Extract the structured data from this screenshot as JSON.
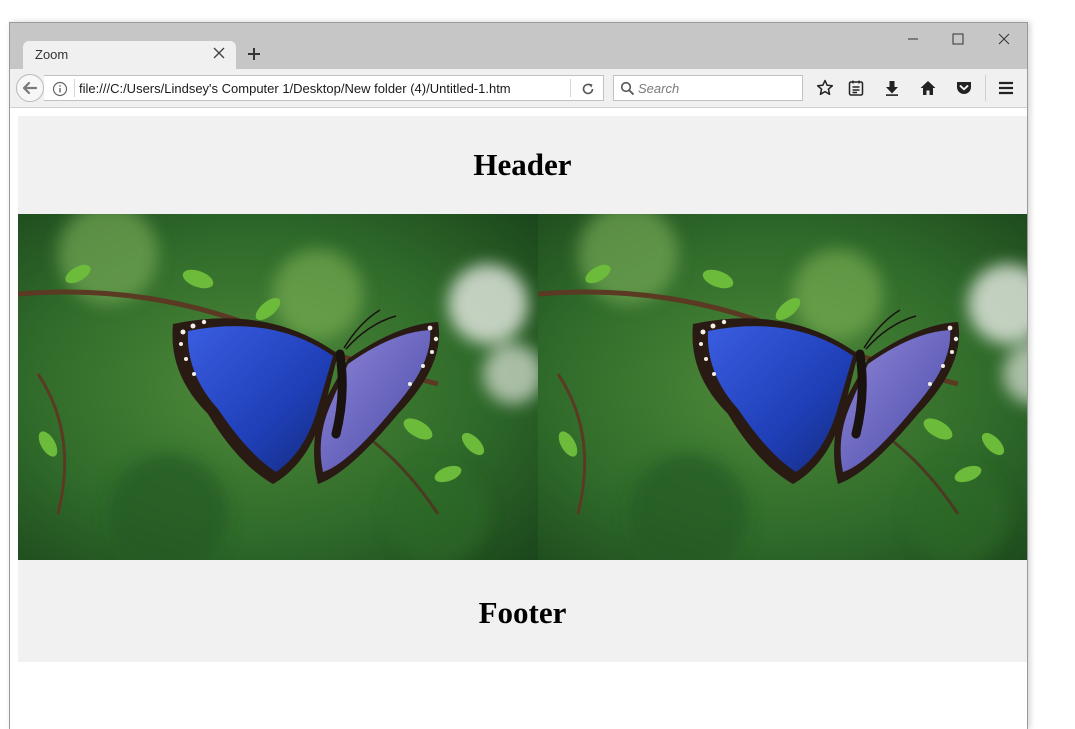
{
  "browser": {
    "tab_title": "Zoom",
    "url": "file:///C:/Users/Lindsey's Computer 1/Desktop/New folder (4)/Untitled-1.htm",
    "search_placeholder": "Search",
    "icons": {
      "back": "back-arrow-icon",
      "info": "info-icon",
      "reload": "reload-icon",
      "search": "search-icon",
      "bookmark": "star-icon",
      "reader": "reading-list-icon",
      "downloads": "download-arrow-icon",
      "home": "home-icon",
      "pocket": "pocket-icon",
      "menu": "hamburger-menu-icon"
    }
  },
  "page": {
    "header_text": "Header",
    "footer_text": "Footer",
    "images": [
      {
        "subject": "blue morpho butterfly on green branch"
      },
      {
        "subject": "blue morpho butterfly on green branch"
      }
    ]
  },
  "colors": {
    "titlebar": "#c6c6c6",
    "toolbar": "#f0f0f0",
    "band": "#f1f1f1"
  }
}
